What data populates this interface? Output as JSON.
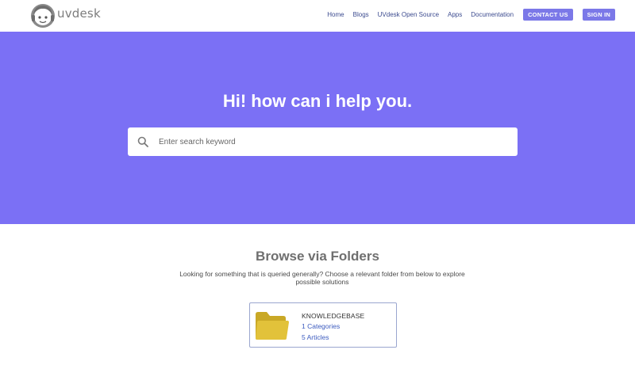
{
  "header": {
    "logo_text": "uvdesk",
    "nav_links": [
      "Home",
      "Blogs",
      "UVdesk Open Source",
      "Apps",
      "Documentation"
    ],
    "contact_label": "CONTACT US",
    "signin_label": "SIGN IN"
  },
  "hero": {
    "title": "Hi! how can i help you.",
    "search_placeholder": "Enter search keyword"
  },
  "browse": {
    "title": "Browse via Folders",
    "description": "Looking for something that is queried generally? Choose a relevant folder from below to explore possible solutions"
  },
  "folders": [
    {
      "name": "KNOWLEDGEBASE",
      "categories": "1 Categories",
      "articles": "5 Articles"
    }
  ],
  "colors": {
    "hero_bg": "#7b70f5",
    "button_bg": "#7b78e8",
    "link": "#3c4b8f",
    "folder": "#e2c23a"
  },
  "icons": [
    "logo-icon",
    "search-icon",
    "folder-icon"
  ]
}
